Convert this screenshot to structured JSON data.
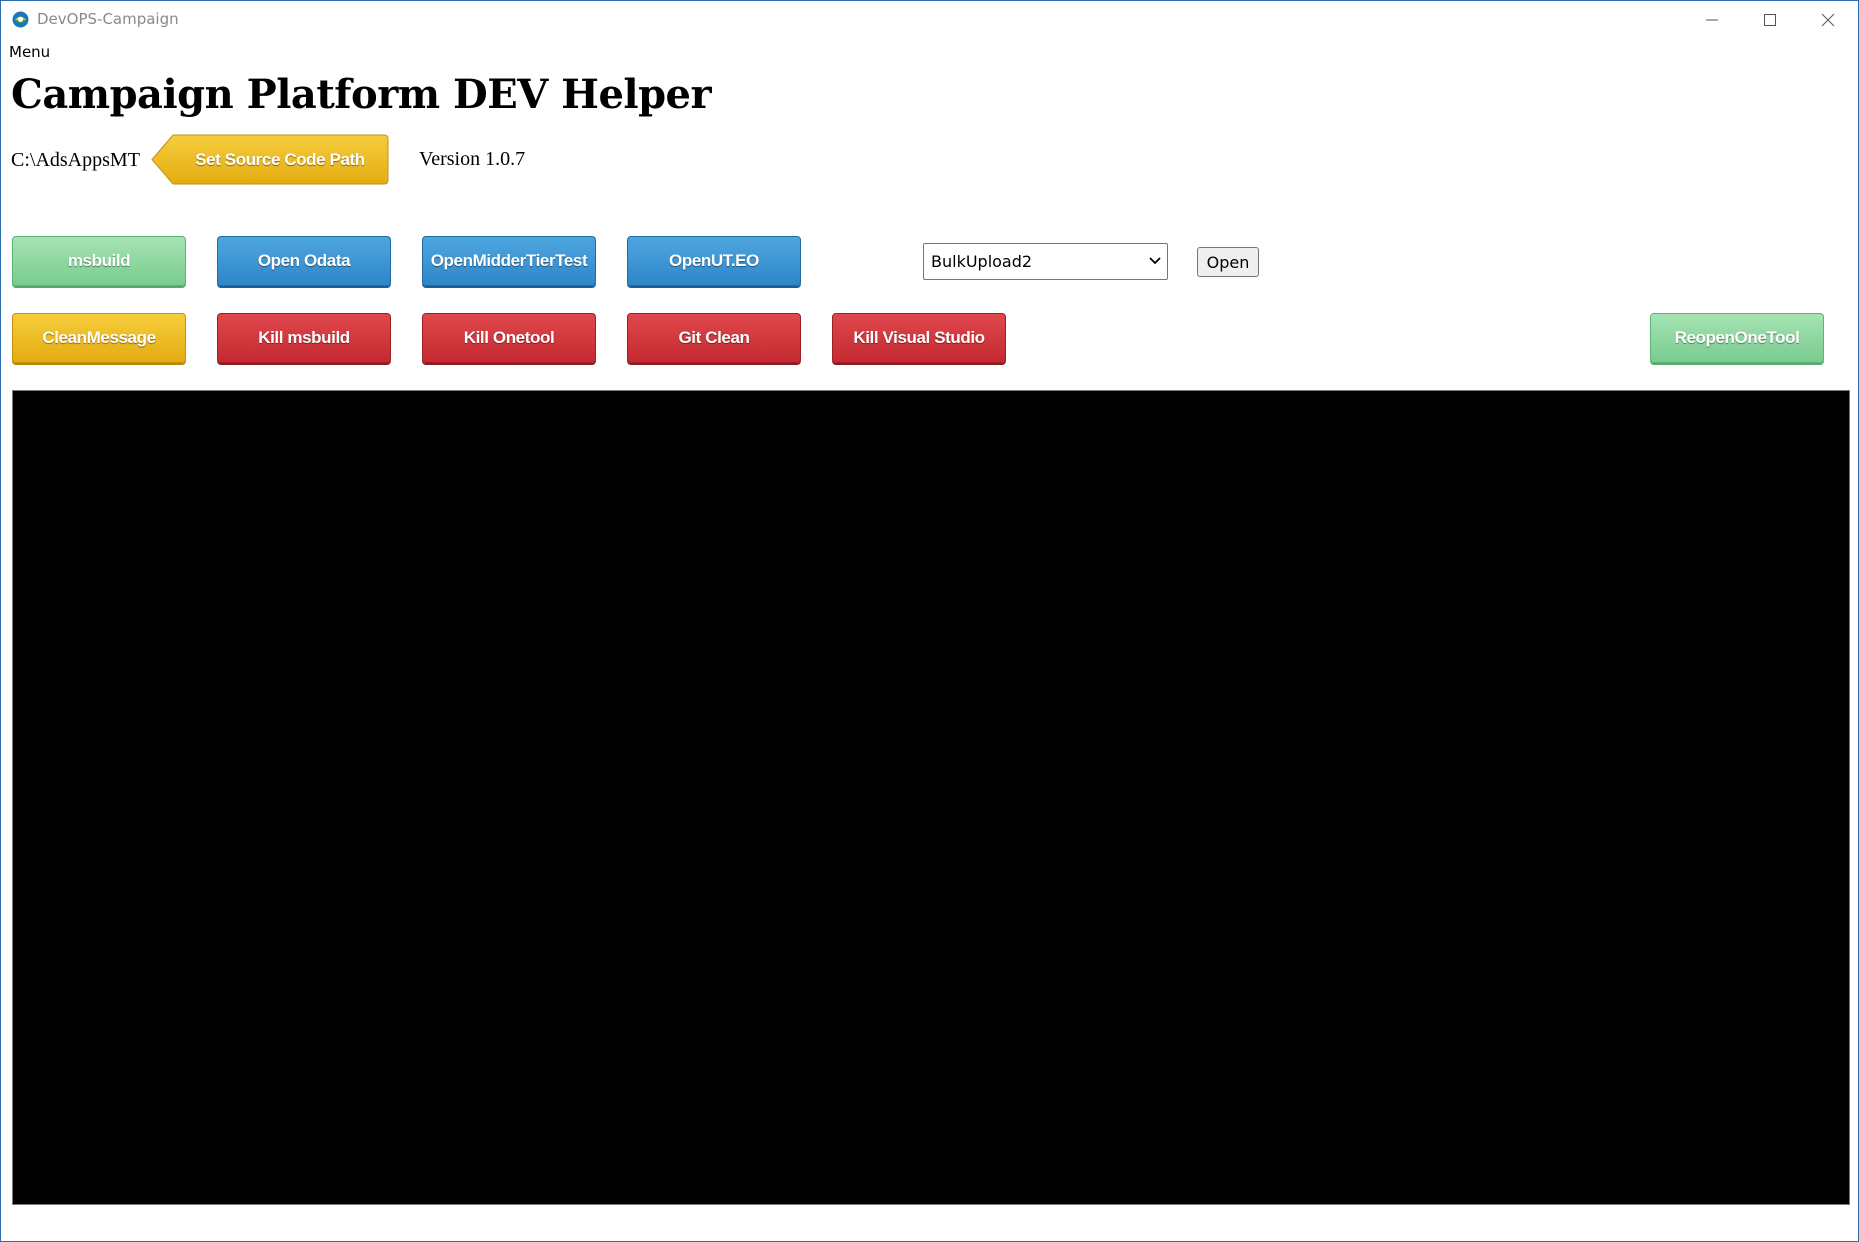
{
  "window": {
    "title": "DevOPS-Campaign",
    "icon": "app-logo-icon"
  },
  "menu": {
    "label": "Menu"
  },
  "header": {
    "title": "Campaign Platform DEV Helper"
  },
  "source": {
    "path": "C:\\AdsAppsMT",
    "set_path_label": "Set Source Code Path",
    "version": "Version 1.0.7"
  },
  "toolbar": {
    "row1": [
      {
        "label": "msbuild",
        "color": "green"
      },
      {
        "label": "Open Odata",
        "color": "blue"
      },
      {
        "label": "OpenMidderTierTest",
        "color": "blue"
      },
      {
        "label": "OpenUT.EO",
        "color": "blue"
      }
    ],
    "row2": [
      {
        "label": "CleanMessage",
        "color": "yellow"
      },
      {
        "label": "Kill msbuild",
        "color": "red"
      },
      {
        "label": "Kill Onetool",
        "color": "red"
      },
      {
        "label": "Git Clean",
        "color": "red"
      },
      {
        "label": "Kill Visual Studio",
        "color": "red"
      }
    ],
    "reopen_label": "ReopenOneTool"
  },
  "selector": {
    "selected": "BulkUpload2",
    "open_label": "Open"
  },
  "colors": {
    "green": "#79cc8e",
    "blue": "#2f86c8",
    "yellow": "#e4ac12",
    "red": "#c42a30",
    "console_bg": "#000000"
  }
}
